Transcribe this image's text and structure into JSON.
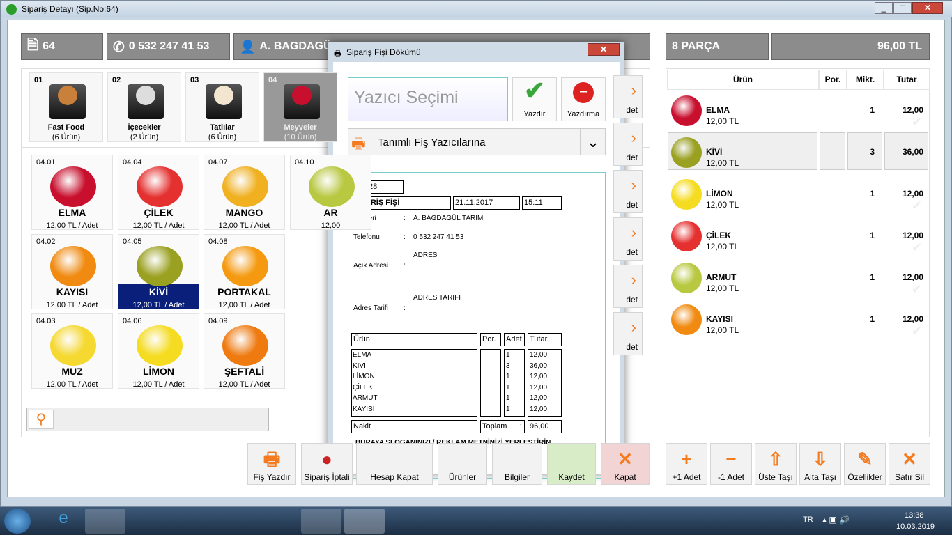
{
  "window": {
    "title": "Sipariş Detayı (Sip.No:64)"
  },
  "header": {
    "order_no": "64",
    "phone": "0 532 247 41 53",
    "customer": "A. BAGDAGÜL TARIM",
    "parts": "8 PARÇA",
    "total": "96,00 TL"
  },
  "categories": [
    {
      "no": "01",
      "name": "Fast Food",
      "count": "(6 Ürün)",
      "color": "#c8803a"
    },
    {
      "no": "02",
      "name": "İçecekler",
      "count": "(2 Ürün)",
      "color": "#ddd"
    },
    {
      "no": "03",
      "name": "Tatlılar",
      "count": "(6 Ürün)",
      "color": "#f3e6d0"
    },
    {
      "no": "04",
      "name": "Meyveler",
      "count": "(10 Ürün)",
      "color": "#c8102e"
    }
  ],
  "products": [
    {
      "no": "04.01",
      "name": "ELMA",
      "price": "12,00 TL / Adet",
      "color": "#c8102e"
    },
    {
      "no": "04.04",
      "name": "ÇİLEK",
      "price": "12,00 TL / Adet",
      "color": "#e53030"
    },
    {
      "no": "04.07",
      "name": "MANGO",
      "price": "12,00 TL / Adet",
      "color": "#f0b020"
    },
    {
      "no": "04.10",
      "name": "AR",
      "price": "12,00",
      "color": "#b8c840"
    },
    {
      "no": "04.02",
      "name": "KAYISI",
      "price": "12,00 TL / Adet",
      "color": "#f08a10"
    },
    {
      "no": "04.05",
      "name": "KİVİ",
      "price": "12,00 TL / Adet",
      "color": "#9aa020",
      "selected": true
    },
    {
      "no": "04.08",
      "name": "PORTAKAL",
      "price": "12,00 TL / Adet",
      "color": "#f59a10"
    },
    {
      "no": "04.03",
      "name": "MUZ",
      "price": "12,00 TL / Adet",
      "color": "#f5d830"
    },
    {
      "no": "04.06",
      "name": "LİMON",
      "price": "12,00 TL / Adet",
      "color": "#f5dc20"
    },
    {
      "no": "04.09",
      "name": "ŞEFTALİ",
      "price": "12,00 TL / Adet",
      "color": "#ee7a10"
    }
  ],
  "side_buttons": [
    "det",
    "det",
    "det",
    "det",
    "det",
    "det"
  ],
  "search": {
    "placeholder": "",
    "icon": "search-icon"
  },
  "bottom_buttons": [
    {
      "label": "Fiş Yazdır",
      "icon": "printer-icon"
    },
    {
      "label": "Sipariş İptali",
      "icon": "cancel-icon"
    },
    {
      "label": "Hesap Kapat",
      "icon": "cash-icon"
    },
    {
      "label": "Ürünler",
      "icon": "list-icon"
    },
    {
      "label": "Bilgiler",
      "icon": "info-icon"
    },
    {
      "label": "Kaydet",
      "icon": "save-icon"
    },
    {
      "label": "Kapat",
      "icon": "close-icon"
    }
  ],
  "order_table": {
    "headers": [
      "Ürün",
      "Por.",
      "Mikt.",
      "Tutar"
    ],
    "rows": [
      {
        "name": "ELMA",
        "price": "12,00 TL",
        "qty": "1",
        "total": "12,00",
        "color": "#c8102e"
      },
      {
        "name": "KİVİ",
        "price": "12,00 TL",
        "qty": "3",
        "total": "36,00",
        "color": "#9aa020",
        "selected": true
      },
      {
        "name": "LİMON",
        "price": "12,00 TL",
        "qty": "1",
        "total": "12,00",
        "color": "#f5dc20"
      },
      {
        "name": "ÇİLEK",
        "price": "12,00 TL",
        "qty": "1",
        "total": "12,00",
        "color": "#e53030"
      },
      {
        "name": "ARMUT",
        "price": "12,00 TL",
        "qty": "1",
        "total": "12,00",
        "color": "#b8c840"
      },
      {
        "name": "KAYISI",
        "price": "12,00 TL",
        "qty": "1",
        "total": "12,00",
        "color": "#f08a10"
      }
    ]
  },
  "right_buttons": [
    {
      "label": "+1 Adet",
      "icon": "plus-icon",
      "glyph": "+"
    },
    {
      "label": "-1 Adet",
      "icon": "minus-icon",
      "glyph": "−"
    },
    {
      "label": "Üste Taşı",
      "icon": "arrow-up-icon",
      "glyph": "⇧"
    },
    {
      "label": "Alta Taşı",
      "icon": "arrow-down-icon",
      "glyph": "⇩"
    },
    {
      "label": "Özellikler",
      "icon": "pencil-icon",
      "glyph": "✎"
    },
    {
      "label": "Satır Sil",
      "icon": "delete-icon",
      "glyph": "✕"
    }
  ],
  "dialog": {
    "title": "Sipariş Fişi Dökümü",
    "printer_select": "Yazıcı Seçimi",
    "print_label": "Yazdır",
    "noprint_label": "Yazdırma",
    "dropdown_value": "Tanımlı Fiş Yazıcılarına",
    "receipt": {
      "code": "ANT28",
      "title": "SİPARİŞ FİŞİ",
      "date": "21.11.2017",
      "time": "15:11",
      "customer_label": "Müşteri",
      "customer": "A. BAGDAGÜL TARIM",
      "phone_label": "Telefonu",
      "phone": "0 532 247 41 53",
      "address_label": "Açık Adresi",
      "address": "ADRES",
      "directions_label": "Adres Tarifi",
      "directions": "ADRES TARIFI",
      "colon": ":",
      "headers": [
        "Ürün",
        "Por.",
        "Adet",
        "Tutar"
      ],
      "items": [
        {
          "name": "ELMA",
          "qty": "1",
          "total": "12,00"
        },
        {
          "name": "KİVİ",
          "qty": "3",
          "total": "36,00"
        },
        {
          "name": "LİMON",
          "qty": "1",
          "total": "12,00"
        },
        {
          "name": "ÇİLEK",
          "qty": "1",
          "total": "12,00"
        },
        {
          "name": "ARMUT",
          "qty": "1",
          "total": "12,00"
        },
        {
          "name": "KAYISI",
          "qty": "1",
          "total": "12,00"
        }
      ],
      "payment": "Nakit",
      "total_label": "Toplam      :",
      "total": "96,00",
      "slogan": "BURAYA SLOGANINIZI / REKLAM METNİNİZİ YERLEŞTİRİN"
    }
  },
  "taskbar": {
    "lang": "TR",
    "time": "13:38",
    "date": "10.03.2019"
  }
}
